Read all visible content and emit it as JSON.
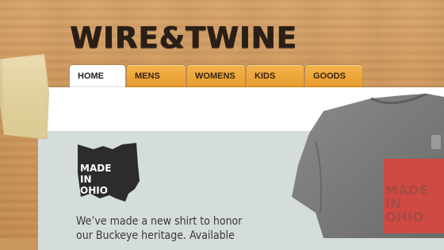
{
  "brand": {
    "logo_text": "WIRE&TWINE"
  },
  "nav": {
    "tabs": [
      {
        "label": "HOME",
        "active": true
      },
      {
        "label": "MENS",
        "active": false
      },
      {
        "label": "WOMENS",
        "active": false
      },
      {
        "label": "KIDS",
        "active": false
      },
      {
        "label": "GOODS",
        "active": false
      }
    ]
  },
  "feature": {
    "badge_lines": [
      "MADE",
      "IN",
      "OHIO"
    ],
    "text_lines": [
      "We’ve made a new shirt to honor",
      "our Buckeye heritage. Available"
    ],
    "shirt_print_lines": [
      "MADE",
      "IN",
      "OHIO"
    ]
  },
  "colors": {
    "tab_orange": "#e89b2e",
    "tab_active": "#ffffff",
    "panel_bg": "#d4dddb",
    "shirt_gray": "#7d7d7d",
    "shirt_print": "#d6463f"
  }
}
